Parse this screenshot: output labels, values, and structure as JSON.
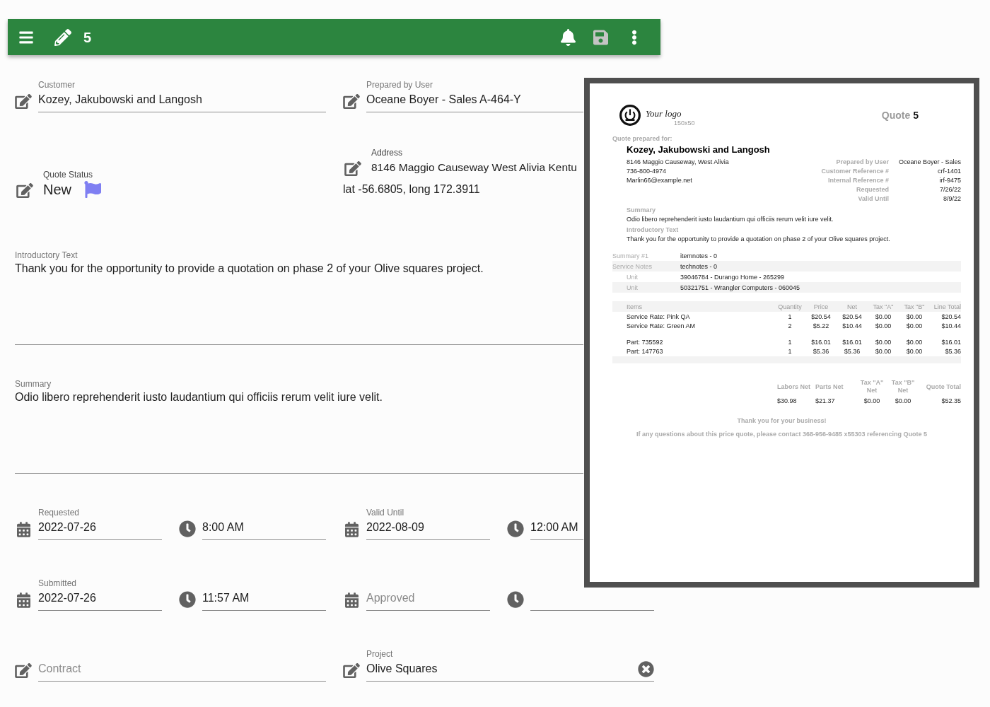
{
  "app_bar": {
    "title": "5",
    "save": {
      "disabled": true
    }
  },
  "customer_row": [
    {
      "label": "Customer",
      "value": "Kozey, Jakubowski and Langosh"
    },
    {
      "label": "Prepared by User",
      "value": "Oceane Boyer - Sales A-464-Y"
    }
  ],
  "quote_status": {
    "label": "Quote Status",
    "value": "New"
  },
  "address": {
    "label": "Address",
    "value": "8146 Maggio Causeway West Alivia Kentu",
    "location": "lat -56.6805, long 172.3911"
  },
  "text_fields": [
    {
      "label": "Introductory Text",
      "value": "Thank you for the opportunity to provide a quotation on phase 2 of your Olive squares project."
    },
    {
      "label": "Summary",
      "value": "Odio libero reprehenderit iusto laudantium qui officiis rerum velit iure velit."
    }
  ],
  "schedule_rows": [
    [
      {
        "kind": "date",
        "label": "Requested",
        "value": "2022-07-26"
      },
      {
        "kind": "time",
        "value": "8:00 AM"
      },
      {
        "kind": "date",
        "label": "Valid Until",
        "value": "2022-08-09"
      },
      {
        "kind": "time",
        "value": "12:00 AM"
      }
    ],
    [
      {
        "kind": "date",
        "label": "Submitted",
        "value": "2022-07-26"
      },
      {
        "kind": "time",
        "value": "11:57 AM"
      },
      {
        "kind": "date",
        "placeholder": "Approved"
      },
      {
        "kind": "time"
      }
    ]
  ],
  "link_row": [
    {
      "placeholder": "Contract",
      "clearable": false
    },
    {
      "label": "Project",
      "value": "Olive Squares",
      "clearable": true
    }
  ],
  "preview": {
    "logo": {
      "text": "Your logo",
      "size": "150x50"
    },
    "title": {
      "label": "Quote",
      "number": "5"
    },
    "prepared_for_label": "Quote prepared for:",
    "customer_name": "Kozey, Jakubowski and Langosh",
    "contact_lines": [
      "8146 Maggio Causeway, West Alivia",
      "736-800-4974",
      "Marlin66@example.net"
    ],
    "details": [
      {
        "label": "Prepared by User",
        "value": "Oceane Boyer - Sales"
      },
      {
        "label": "Customer Reference #",
        "value": "crf-1401"
      },
      {
        "label": "Internal Reference #",
        "value": "irf-9475"
      },
      {
        "label": "Requested",
        "value": "7/26/22"
      },
      {
        "label": "Valid Until",
        "value": "8/9/22"
      }
    ],
    "sections": [
      {
        "label": "Summary",
        "text": "Odio libero reprehenderit iusto laudantium qui officiis rerum velit iure velit."
      },
      {
        "label": "Introductory Text",
        "text": "Thank you for the opportunity to provide a quotation on phase 2 of your Olive squares project."
      }
    ],
    "notes": [
      {
        "label": "Summary #1",
        "value": "itemnotes - 0"
      },
      {
        "label": "Service Notes",
        "value": "technotes - 0",
        "children": [
          {
            "label": "Unit",
            "value": "39046784 - Durango Home - 265299"
          },
          {
            "label": "Unit",
            "value": "50321751 - Wrangler Computers - 060045"
          }
        ]
      }
    ],
    "items": {
      "columns": [
        "Items",
        "Quantity",
        "Price",
        "Net",
        "Tax \"A\"",
        "Tax \"B\"",
        "Line Total"
      ],
      "groups": [
        [
          [
            "Service Rate: Pink QA",
            "1",
            "$20.54",
            "$20.54",
            "$0.00",
            "$0.00",
            "$20.54"
          ],
          [
            "Service Rate: Green AM",
            "2",
            "$5.22",
            "$10.44",
            "$0.00",
            "$0.00",
            "$10.44"
          ]
        ],
        [
          [
            "Part: 735592",
            "1",
            "$16.01",
            "$16.01",
            "$0.00",
            "$0.00",
            "$16.01"
          ],
          [
            "Part: 147763",
            "1",
            "$5.36",
            "$5.36",
            "$0.00",
            "$0.00",
            "$5.36"
          ]
        ]
      ]
    },
    "totals": {
      "columns": [
        "Labors Net",
        "Parts Net",
        "Tax \"A\" Net",
        "Tax \"B\" Net",
        "Quote Total"
      ],
      "values": [
        "$30.98",
        "$21.37",
        "$0.00",
        "$0.00",
        "$52.35"
      ]
    },
    "footer": [
      "Thank you for your business!",
      "If any questions about this price quote, please contact 368-956-9485 x55303 referencing Quote 5"
    ]
  }
}
